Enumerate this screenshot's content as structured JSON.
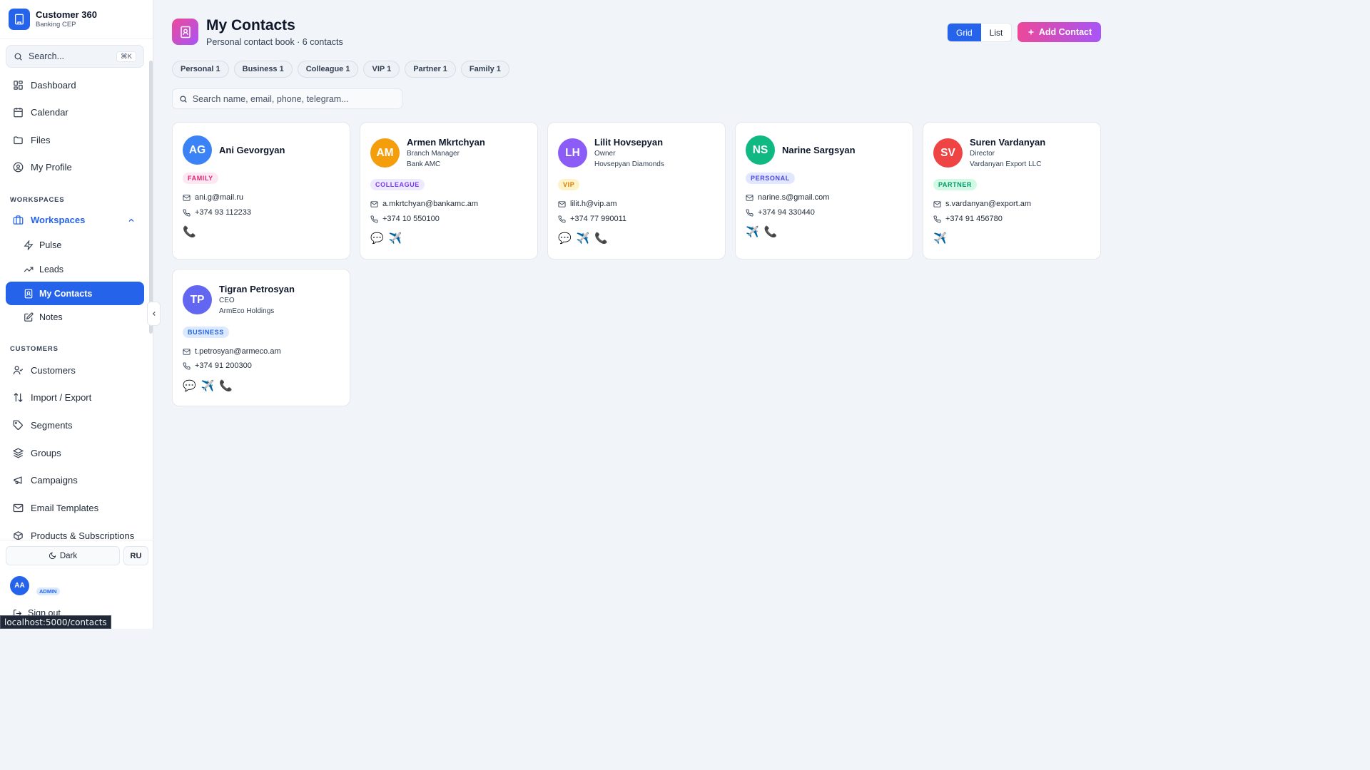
{
  "app": {
    "name": "Customer 360",
    "subtitle": "Banking CEP"
  },
  "sidebar": {
    "search_label": "Search...",
    "search_shortcut": "⌘K",
    "nav": [
      {
        "label": "Dashboard",
        "icon": "dashboard-icon"
      },
      {
        "label": "Calendar",
        "icon": "calendar-icon"
      },
      {
        "label": "Files",
        "icon": "folder-icon"
      },
      {
        "label": "My Profile",
        "icon": "user-circle-icon"
      }
    ],
    "workspaces_section": "WORKSPACES",
    "workspaces_group": "Workspaces",
    "workspace_items": [
      {
        "label": "Pulse",
        "icon": "zap-icon"
      },
      {
        "label": "Leads",
        "icon": "trending-up-icon"
      },
      {
        "label": "My Contacts",
        "icon": "contact-book-icon",
        "active": true
      },
      {
        "label": "Notes",
        "icon": "edit-note-icon"
      }
    ],
    "customers_section": "CUSTOMERS",
    "customer_items": [
      {
        "label": "Customers",
        "icon": "user-check-icon"
      },
      {
        "label": "Import / Export",
        "icon": "arrows-updown-icon"
      },
      {
        "label": "Segments",
        "icon": "tag-icon"
      },
      {
        "label": "Groups",
        "icon": "layers-icon"
      },
      {
        "label": "Campaigns",
        "icon": "megaphone-icon"
      },
      {
        "label": "Email Templates",
        "icon": "mail-icon"
      },
      {
        "label": "Products & Subscriptions",
        "icon": "package-icon"
      }
    ],
    "theme_button": "Dark",
    "lang_button": "RU",
    "user_initials": "AA",
    "user_role": "ADMIN",
    "sign_out": "Sign out"
  },
  "status_url": "localhost:5000/contacts",
  "header": {
    "title": "My Contacts",
    "subtitle": "Personal contact book · 6 contacts",
    "view_grid": "Grid",
    "view_list": "List",
    "add_button": "Add Contact"
  },
  "filters": [
    "Personal 1",
    "Business 1",
    "Colleague 1",
    "VIP 1",
    "Partner 1",
    "Family 1"
  ],
  "search_placeholder": "Search name, email, phone, telegram...",
  "contacts": [
    {
      "initials": "AG",
      "name": "Ani Gevorgyan",
      "title": "",
      "company": "",
      "tag": "FAMILY",
      "email": "ani.g@mail.ru",
      "phone": "+374 93 112233",
      "avatar_color": "#3b82f6",
      "tag_color": "#db2777",
      "tag_bg": "#fce7f3",
      "actions": [
        "📞"
      ]
    },
    {
      "initials": "AM",
      "name": "Armen Mkrtchyan",
      "title": "Branch Manager",
      "company": "Bank AMC",
      "tag": "COLLEAGUE",
      "email": "a.mkrtchyan@bankamc.am",
      "phone": "+374 10 550100",
      "avatar_color": "#f59e0b",
      "tag_color": "#7c3aed",
      "tag_bg": "#ede9fe",
      "actions": [
        "💬",
        "✈️"
      ]
    },
    {
      "initials": "LH",
      "name": "Lilit Hovsepyan",
      "title": "Owner",
      "company": "Hovsepyan Diamonds",
      "tag": "VIP",
      "email": "lilit.h@vip.am",
      "phone": "+374 77 990011",
      "avatar_color": "#8b5cf6",
      "tag_color": "#d97706",
      "tag_bg": "#fef3c7",
      "actions": [
        "💬",
        "✈️",
        "📞"
      ]
    },
    {
      "initials": "NS",
      "name": "Narine Sargsyan",
      "title": "",
      "company": "",
      "tag": "PERSONAL",
      "email": "narine.s@gmail.com",
      "phone": "+374 94 330440",
      "avatar_color": "#10b981",
      "tag_color": "#4f46e5",
      "tag_bg": "#e0e7ff",
      "actions": [
        "✈️",
        "📞"
      ]
    },
    {
      "initials": "SV",
      "name": "Suren Vardanyan",
      "title": "Director",
      "company": "Vardanyan Export LLC",
      "tag": "PARTNER",
      "email": "s.vardanyan@export.am",
      "phone": "+374 91 456780",
      "avatar_color": "#ef4444",
      "tag_color": "#059669",
      "tag_bg": "#d1fae5",
      "actions": [
        "✈️"
      ]
    },
    {
      "initials": "TP",
      "name": "Tigran Petrosyan",
      "title": "CEO",
      "company": "ArmEco Holdings",
      "tag": "BUSINESS",
      "email": "t.petrosyan@armeco.am",
      "phone": "+374 91 200300",
      "avatar_color": "#6366f1",
      "tag_color": "#2563eb",
      "tag_bg": "#dbeafe",
      "actions": [
        "💬",
        "✈️",
        "📞"
      ]
    }
  ]
}
